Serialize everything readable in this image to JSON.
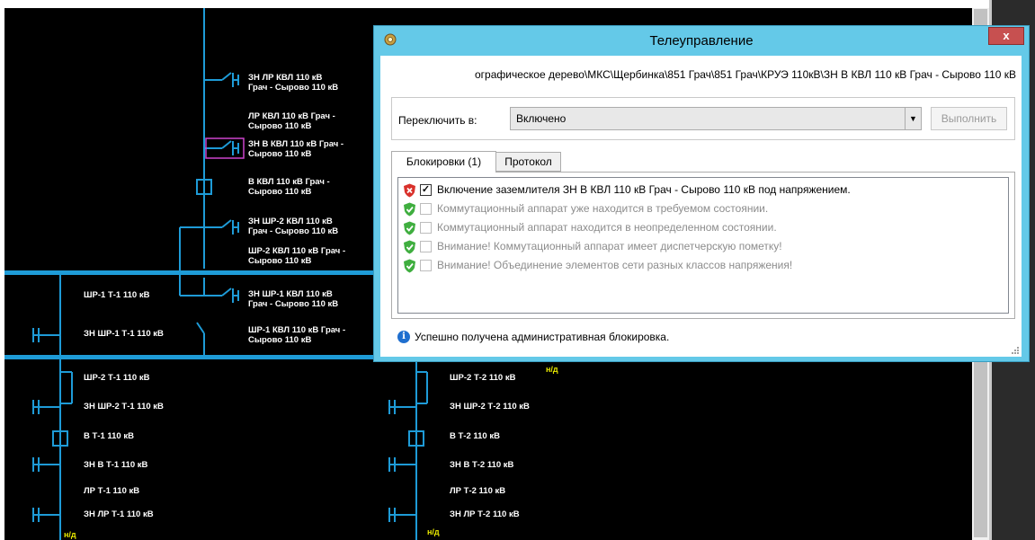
{
  "scheme": {
    "upper_labels": [
      "ЗН ЛР КВЛ 110 кВ\nГрач - Сырово 110 кВ",
      "ЛР КВЛ 110 кВ Грач -\nСырово 110 кВ",
      "ЗН В КВЛ 110 кВ Грач -\nСырово 110 кВ",
      "В КВЛ 110 кВ Грач -\nСырово 110 кВ",
      "ЗН ШР-2 КВЛ 110 кВ\nГрач - Сырово 110 кВ",
      "ШР-2 КВЛ 110 кВ Грач -\nСырово 110 кВ",
      "ЗН ШР-1 КВЛ 110 кВ\nГрач - Сырово 110 кВ",
      "ШР-1 КВЛ 110 кВ Грач -\nСырово 110 кВ"
    ],
    "t1_labels": [
      "ШР-1 Т-1 110 кВ",
      "ЗН ШР-1 Т-1 110 кВ",
      "ШР-2 Т-1 110 кВ",
      "ЗН ШР-2 Т-1 110 кВ",
      "В Т-1 110 кВ",
      "ЗН В Т-1 110 кВ",
      "ЛР Т-1 110 кВ",
      "ЗН ЛР Т-1 110 кВ"
    ],
    "t2_labels": [
      "ШР-2 Т-2 110 кВ",
      "ЗН ШР-2 Т-2 110 кВ",
      "В Т-2 110 кВ",
      "ЗН В Т-2 110 кВ",
      "ЛР Т-2 110 кВ",
      "ЗН ЛР Т-2 110 кВ"
    ],
    "nd_label": "н/д",
    "line_color": "#1e9bd7",
    "highlight_color": "#cc44cc"
  },
  "dialog": {
    "title": "Телеуправление",
    "close_glyph": "x",
    "path": "ографическое дерево\\МКС\\Щербинка\\851 Грач\\851 Грач\\КРУЭ 110кВ\\ЗН В КВЛ 110 кВ Грач - Сырово 110 кВ",
    "switch_label": "Переключить в:",
    "switch_value": "Включено",
    "execute_label": "Выполнить",
    "tabs": [
      "Блокировки (1)",
      "Протокол"
    ],
    "blocks": [
      {
        "text": "Включение заземлителя ЗН В КВЛ 110 кВ Грач - Сырово 110 кВ под напряжением.",
        "icon": "shield-error-icon",
        "checked": true
      },
      {
        "text": "Коммутационный аппарат уже находится в требуемом состоянии.",
        "icon": "shield-ok-icon",
        "checked": false
      },
      {
        "text": "Коммутационный аппарат находится в неопределенном состоянии.",
        "icon": "shield-ok-icon",
        "checked": false
      },
      {
        "text": "Внимание! Коммутационный аппарат имеет диспетчерскую пометку!",
        "icon": "shield-ok-icon",
        "checked": false
      },
      {
        "text": "Внимание! Объединение элементов сети разных классов напряжения!",
        "icon": "shield-ok-icon",
        "checked": false
      }
    ],
    "status_text": "Успешно получена административная блокировка.",
    "check_glyph": "✓",
    "info_glyph": "i"
  },
  "colors": {
    "title_bg": "#64c9e8",
    "close_bg": "#c75050",
    "error_shield": "#d9312b",
    "ok_shield": "#3fae3f",
    "info": "#1f6fcf"
  }
}
